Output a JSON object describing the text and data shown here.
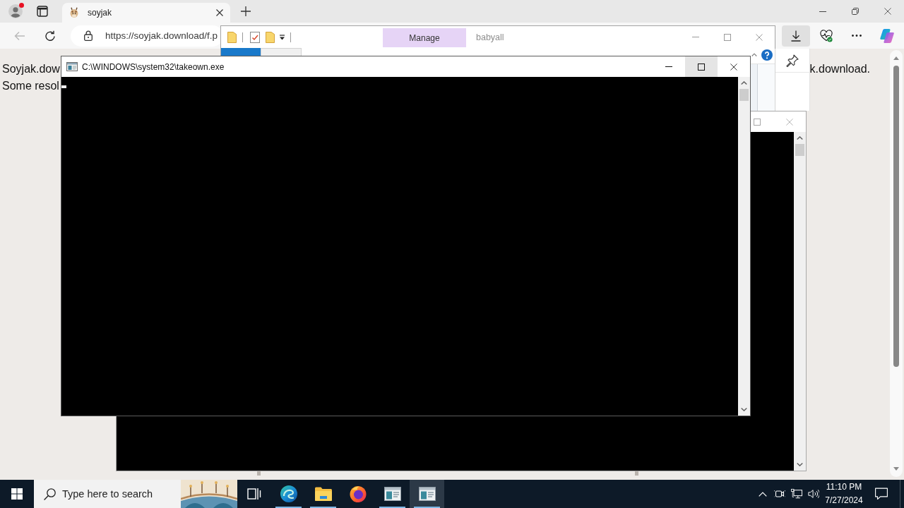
{
  "browser": {
    "profile": {
      "notification": true
    },
    "tabs": [
      {
        "title": "soyjak",
        "selected": true
      }
    ],
    "back_disabled": true,
    "address": "https://soyjak.download/f.p",
    "toolbar_buttons": [
      {
        "kind": "downloads",
        "active": true
      },
      {
        "kind": "essentials",
        "active": false
      },
      {
        "kind": "more",
        "active": false
      },
      {
        "kind": "copilot",
        "active": false
      }
    ],
    "page_lines": [
      {
        "left": "Soyjak.dow",
        "right": "k.download."
      },
      {
        "left": "Some resol"
      }
    ]
  },
  "explorer": {
    "active": false,
    "contextual_group": "Manage",
    "title": "babyall",
    "ribbon_tabs": [
      {
        "kind": "file",
        "selected": false
      },
      {
        "kind": "tab",
        "selected": true
      }
    ]
  },
  "console_windows": [
    {
      "title": "C:\\WINDOWS\\system32\\takeown.exe",
      "active": true,
      "cursor": true,
      "buttons": [
        {
          "kind": "minimize",
          "hovered": false
        },
        {
          "kind": "maximize",
          "hovered": true
        },
        {
          "kind": "close",
          "hovered": false
        }
      ]
    },
    {
      "active": false,
      "buttons": [
        {
          "kind": "maximize",
          "hovered": false
        },
        {
          "kind": "close",
          "hovered": false
        }
      ]
    }
  ],
  "taskbar": {
    "search_placeholder": "Type here to search",
    "apps": [
      {
        "kind": "edge",
        "running": true,
        "active": false
      },
      {
        "kind": "explorer",
        "running": true,
        "active": false
      },
      {
        "kind": "firefox",
        "running": false,
        "active": false
      },
      {
        "kind": "console",
        "running": true,
        "active": false
      },
      {
        "kind": "console",
        "running": true,
        "active": true
      }
    ],
    "time": "11:10 PM",
    "date": "7/27/2024"
  }
}
